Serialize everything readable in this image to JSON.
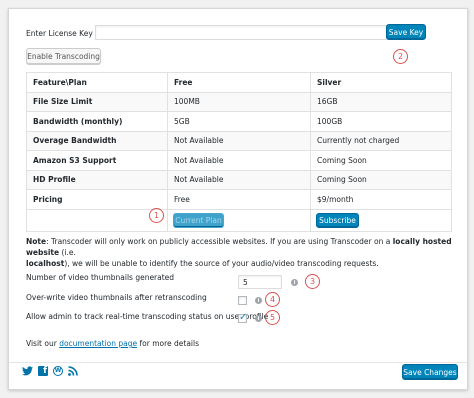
{
  "license": {
    "label": "Enter License Key",
    "value": "",
    "save_label": "Save Key",
    "marker": "2"
  },
  "enable_transcoding_label": "Enable Transcoding",
  "plans_table": {
    "headers": [
      "Feature\\Plan",
      "Free",
      "Silver"
    ],
    "rows": [
      [
        "File Size Limit",
        "100MB",
        "16GB"
      ],
      [
        "Bandwidth (monthly)",
        "5GB",
        "100GB"
      ],
      [
        "Overage Bandwidth",
        "Not Available",
        "Currently not charged"
      ],
      [
        "Amazon S3 Support",
        "Not Available",
        "Coming Soon"
      ],
      [
        "HD Profile",
        "Not Available",
        "Coming Soon"
      ],
      [
        "Pricing",
        "Free",
        "$9/month"
      ]
    ],
    "current_plan_label": "Current Plan",
    "subscribe_label": "Subscribe",
    "marker": "1"
  },
  "note": {
    "bold_prefix": "Note",
    "text1": ": Transcoder will only work on publicly accessible websites. If you are using Transcoder on a ",
    "bold1": "locally hosted website",
    "text2": " (i.e.",
    "bold2": "localhost",
    "text3": "), we will be unable to identify the source of your audio/video transcoding requests."
  },
  "settings": {
    "thumbnails_label": "Number of video thumbnails generated",
    "thumbnails_value": "5",
    "thumbnails_marker": "3",
    "overwrite_label": "Over-write video thumbnails after retranscoding",
    "overwrite_checked": false,
    "overwrite_marker": "4",
    "track_label": "Allow admin to track real-time transcoding status on user profile",
    "track_checked": true,
    "track_marker": "5",
    "info_glyph": "i"
  },
  "docs": {
    "prefix": "Visit our ",
    "link": "documentation page",
    "suffix": " for more details"
  },
  "footer": {
    "save_label": "Save Changes",
    "social_icons": [
      "twitter-icon",
      "facebook-icon",
      "wordpress-icon",
      "rss-icon"
    ]
  },
  "colors": {
    "primary_button": "#0085ba",
    "marker_red": "#d9534f",
    "link": "#0073aa"
  }
}
